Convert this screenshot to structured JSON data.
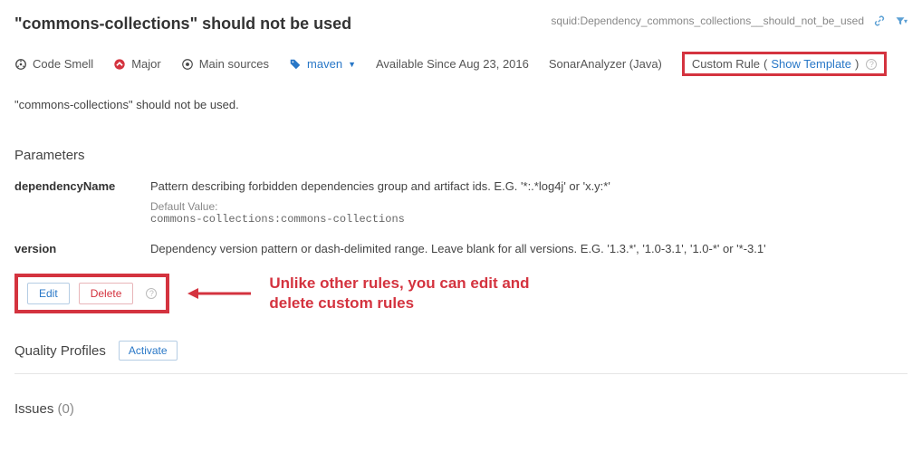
{
  "header": {
    "title": "\"commons-collections\" should not be used",
    "rule_key": "squid:Dependency_commons_collections__should_not_be_used"
  },
  "meta": {
    "type": "Code Smell",
    "severity": "Major",
    "scope": "Main sources",
    "tag": "maven",
    "available_since": "Available Since Aug 23, 2016",
    "analyzer": "SonarAnalyzer (Java)",
    "custom_rule_label": "Custom Rule",
    "show_template": "Show Template"
  },
  "description": "\"commons-collections\" should not be used.",
  "parameters_heading": "Parameters",
  "parameters": [
    {
      "name": "dependencyName",
      "desc": "Pattern describing forbidden dependencies group and artifact ids. E.G. '*:.*log4j' or 'x.y:*'",
      "default_label": "Default Value:",
      "default_value": "commons-collections:commons-collections"
    },
    {
      "name": "version",
      "desc": "Dependency version pattern or dash-delimited range. Leave blank for all versions. E.G. '1.3.*', '1.0-3.1', '1.0-*' or '*-3.1'"
    }
  ],
  "actions": {
    "edit": "Edit",
    "delete": "Delete"
  },
  "annotation": "Unlike other rules, you can edit and delete custom rules",
  "quality_profiles": {
    "heading": "Quality Profiles",
    "activate": "Activate"
  },
  "issues": {
    "label": "Issues",
    "count": "(0)"
  }
}
